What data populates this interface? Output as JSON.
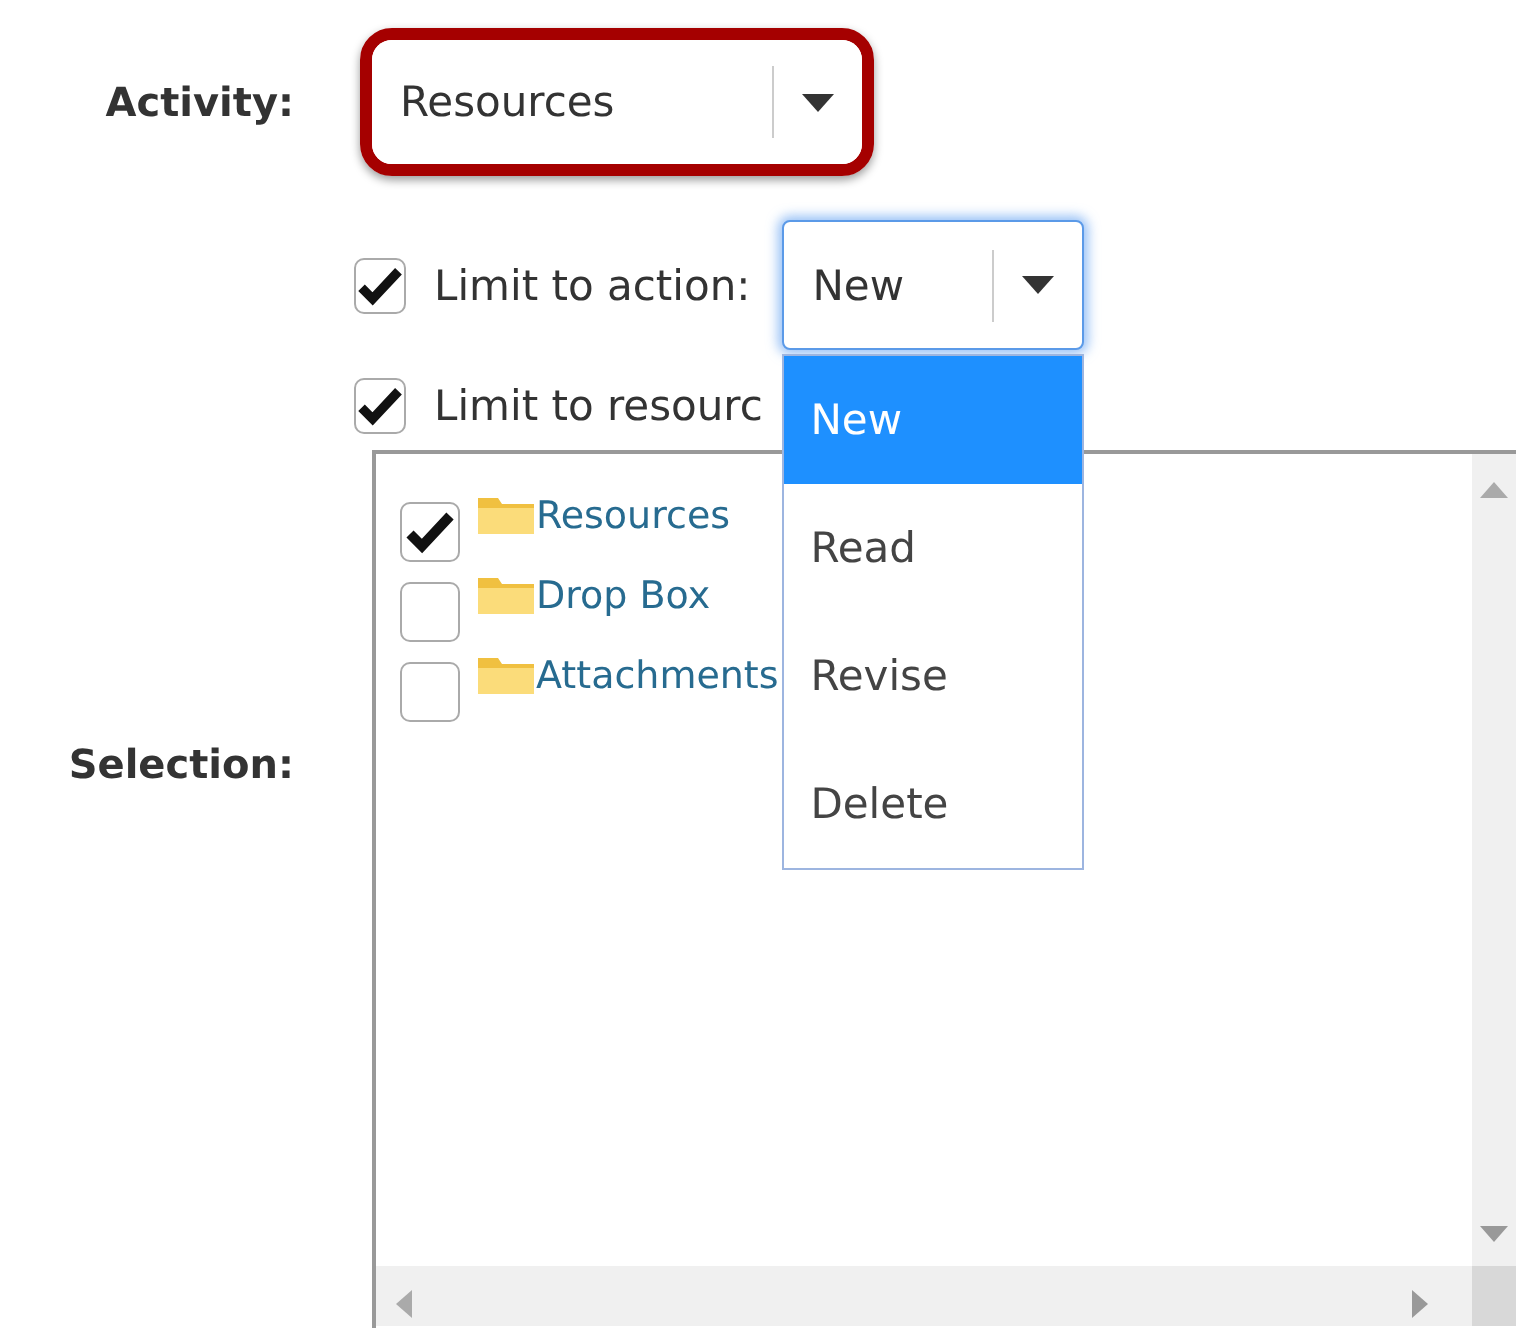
{
  "activity": {
    "label": "Activity:",
    "value": "Resources",
    "highlighted": true
  },
  "limit_action": {
    "label": "Limit to action:",
    "checked": true,
    "value": "New",
    "focused": true,
    "expanded": true,
    "options": [
      {
        "label": "New",
        "selected": true
      },
      {
        "label": "Read",
        "selected": false
      },
      {
        "label": "Revise",
        "selected": false
      },
      {
        "label": "Delete",
        "selected": false
      }
    ]
  },
  "limit_resources": {
    "label": "Limit to resourc",
    "checked": true
  },
  "selection": {
    "label": "Selection:",
    "items": [
      {
        "name": "Resources",
        "checked": true
      },
      {
        "name": "Drop Box",
        "checked": false
      },
      {
        "name": "Attachments",
        "checked": false
      }
    ]
  }
}
